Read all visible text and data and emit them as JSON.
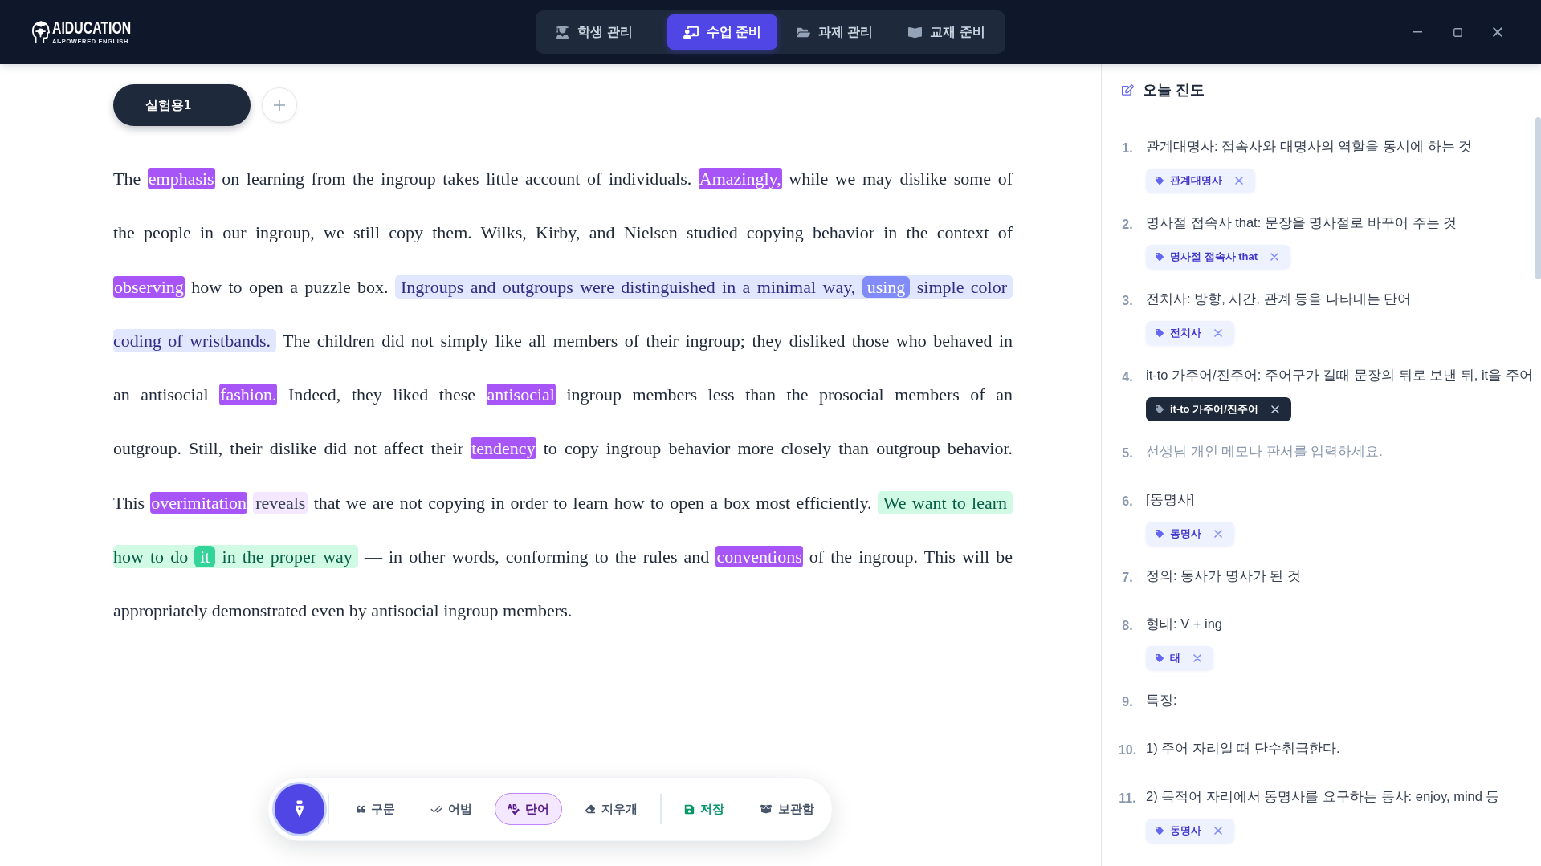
{
  "brand": {
    "name": "AIDUCATION",
    "tagline": "AI-POWERED ENGLISH"
  },
  "nav_tabs": [
    {
      "label": "학생 관리",
      "selected": false
    },
    {
      "label": "수업 준비",
      "selected": true
    },
    {
      "label": "과제 관리",
      "selected": false
    },
    {
      "label": "교재 준비",
      "selected": false
    }
  ],
  "editor": {
    "tabs": [
      {
        "label": "실험용1",
        "selected": true
      }
    ],
    "lines": [
      {
        "segments": [
          {
            "kind": "text",
            "text": "The"
          },
          {
            "kind": "word",
            "text": "emphasis"
          },
          {
            "kind": "text",
            "text": "on learning from the ingroup takes little account of individuals."
          },
          {
            "kind": "word",
            "text": "Amazingly,"
          },
          {
            "kind": "text",
            "text": "while we may dislike some of"
          }
        ]
      },
      {
        "segments": [
          {
            "kind": "text",
            "text": "the people in our ingroup, we still copy them. Wilks, Kirby, and Nielsen studied copying behavior in the context of"
          }
        ]
      },
      {
        "segments": [
          {
            "kind": "word",
            "text": "observing"
          },
          {
            "kind": "text",
            "text": "how to open a puzzle box."
          },
          {
            "kind": "phrase",
            "parts": [
              {
                "kind": "text",
                "text": "Ingroups and outgroups were distinguished in a minimal way,"
              },
              {
                "kind": "key",
                "text": "using"
              },
              {
                "kind": "text",
                "text": "simple color"
              }
            ]
          }
        ]
      },
      {
        "segments": [
          {
            "kind": "phrase",
            "parts": [
              {
                "kind": "text",
                "text": "coding of wristbands."
              }
            ]
          },
          {
            "kind": "text",
            "text": "The children did not simply like all members of their ingroup; they disliked those who behaved in"
          }
        ]
      },
      {
        "segments": [
          {
            "kind": "text",
            "text": "an antisocial"
          },
          {
            "kind": "word",
            "text": "fashion."
          },
          {
            "kind": "text",
            "text": "Indeed, they liked these"
          },
          {
            "kind": "word",
            "text": "antisocial"
          },
          {
            "kind": "text",
            "text": "ingroup members less than the prosocial members of an"
          }
        ]
      },
      {
        "segments": [
          {
            "kind": "text",
            "text": "outgroup. Still, their dislike did not affect their"
          },
          {
            "kind": "word",
            "text": "tendency"
          },
          {
            "kind": "text",
            "text": "to copy ingroup behavior more closely than outgroup behavior."
          }
        ]
      },
      {
        "segments": [
          {
            "kind": "text",
            "text": "This"
          },
          {
            "kind": "word",
            "text": "overimitation"
          },
          {
            "kind": "word_soft",
            "text": "reveals"
          },
          {
            "kind": "text",
            "text": "that we are not copying in order to learn how to open a box most efficiently."
          },
          {
            "kind": "clause",
            "parts": [
              {
                "kind": "text",
                "text": "We want to learn"
              }
            ]
          }
        ]
      },
      {
        "segments": [
          {
            "kind": "clause",
            "parts": [
              {
                "kind": "text",
                "text": "how to do"
              },
              {
                "kind": "key",
                "text": "it"
              },
              {
                "kind": "text",
                "text": "in the proper way"
              }
            ]
          },
          {
            "kind": "text",
            "text": "— in other words, conforming to the rules and"
          },
          {
            "kind": "word",
            "text": "conventions"
          },
          {
            "kind": "text",
            "text": "of the ingroup. This will be"
          }
        ]
      },
      {
        "segments": [
          {
            "kind": "text",
            "text": "appropriately demonstrated even by antisocial ingroup members."
          }
        ]
      }
    ]
  },
  "toolbar": {
    "tools": [
      {
        "label": "구문",
        "kind": "tool",
        "selected": false
      },
      {
        "label": "어법",
        "kind": "tool",
        "selected": false
      },
      {
        "label": "단어",
        "kind": "tool",
        "selected": true
      },
      {
        "label": "지우개",
        "kind": "tool",
        "selected": false
      },
      {
        "label": "저장",
        "kind": "save",
        "selected": false
      },
      {
        "label": "보관함",
        "kind": "storage",
        "selected": false
      }
    ]
  },
  "panel": {
    "title": "오늘 진도",
    "items": [
      {
        "number": "1.",
        "kind": "note",
        "text": "관계대명사: 접속사와 대명사의 역할을 동시에 하는 것",
        "tag": {
          "label": "관계대명사",
          "selected": false
        }
      },
      {
        "number": "2.",
        "kind": "note",
        "text": "명사절 접속사 that: 문장을 명사절로 바꾸어 주는 것",
        "tag": {
          "label": "명사절 접속사 that",
          "selected": false
        }
      },
      {
        "number": "3.",
        "kind": "note",
        "text": "전치사: 방향, 시간, 관계 등을 나타내는 단어",
        "tag": {
          "label": "전치사",
          "selected": false
        }
      },
      {
        "number": "4.",
        "kind": "note",
        "text": "it-to 가주어/진주어: 주어구가 길때 문장의 뒤로 보낸 뒤, it을 주어",
        "tag": {
          "label": "it-to 가주어/진주어",
          "selected": true
        }
      },
      {
        "number": "5.",
        "kind": "memo_input",
        "placeholder": "선생님 개인 메모나 판서를 입력하세요."
      },
      {
        "number": "6.",
        "kind": "note",
        "text": "[동명사]",
        "tag": {
          "label": "동명사",
          "selected": false
        }
      },
      {
        "number": "7.",
        "kind": "note",
        "text": "정의: 동사가 명사가 된 것"
      },
      {
        "number": "8.",
        "kind": "note",
        "text": "형태: V + ing",
        "tag": {
          "label": "태",
          "selected": false
        }
      },
      {
        "number": "9.",
        "kind": "note",
        "text": "특징:"
      },
      {
        "number": "10.",
        "kind": "note",
        "text": "1) 주어 자리일 때 단수취급한다."
      },
      {
        "number": "11.",
        "kind": "note",
        "text": "2) 목적어 자리에서 동명사를 요구하는 동사: enjoy, mind 등",
        "tag": {
          "label": "동명사",
          "selected": false
        }
      }
    ]
  }
}
